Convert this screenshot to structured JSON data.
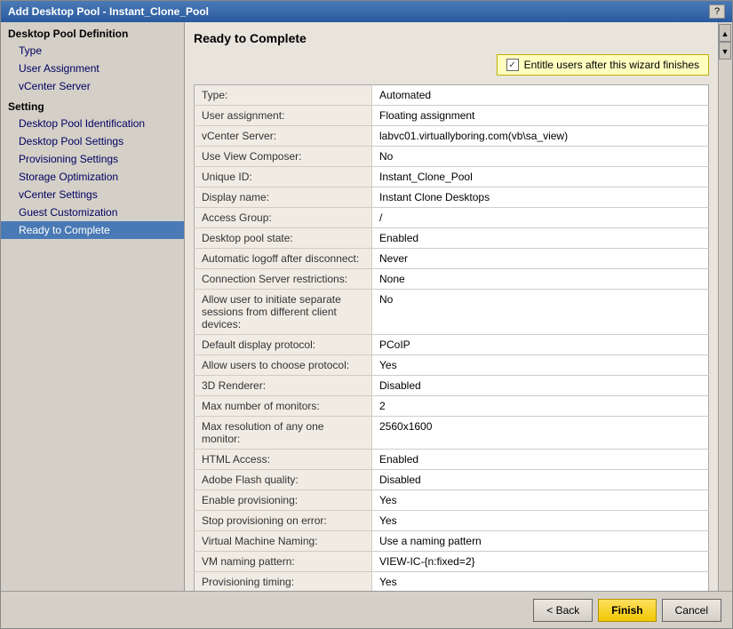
{
  "window": {
    "title": "Add Desktop Pool - Instant_Clone_Pool",
    "help_label": "?"
  },
  "sidebar": {
    "section1_label": "Desktop Pool Definition",
    "items_top": [
      {
        "label": "Type",
        "active": false
      },
      {
        "label": "User Assignment",
        "active": false
      },
      {
        "label": "vCenter Server",
        "active": false
      }
    ],
    "section2_label": "Setting",
    "items_bottom": [
      {
        "label": "Desktop Pool Identification",
        "active": false
      },
      {
        "label": "Desktop Pool Settings",
        "active": false
      },
      {
        "label": "Provisioning Settings",
        "active": false
      },
      {
        "label": "Storage Optimization",
        "active": false
      },
      {
        "label": "vCenter Settings",
        "active": false
      },
      {
        "label": "Guest Customization",
        "active": false
      },
      {
        "label": "Ready to Complete",
        "active": true
      }
    ]
  },
  "content": {
    "page_title": "Ready to Complete",
    "entitle_checkbox_label": "Entitle users after this wizard finishes",
    "entitle_checked": true,
    "table_rows": [
      {
        "label": "Type:",
        "value": "Automated"
      },
      {
        "label": "User assignment:",
        "value": "Floating assignment"
      },
      {
        "label": "vCenter Server:",
        "value": "labvc01.virtuallyboring.com(vb\\sa_view)"
      },
      {
        "label": "Use View Composer:",
        "value": "No"
      },
      {
        "label": "Unique ID:",
        "value": "Instant_Clone_Pool"
      },
      {
        "label": "Display name:",
        "value": "Instant Clone Desktops"
      },
      {
        "label": "Access Group:",
        "value": "/"
      },
      {
        "label": "Desktop pool state:",
        "value": "Enabled"
      },
      {
        "label": "Automatic logoff after disconnect:",
        "value": "Never"
      },
      {
        "label": "Connection Server restrictions:",
        "value": "None"
      },
      {
        "label": "Allow user to initiate separate sessions from different client devices:",
        "value": "No"
      },
      {
        "label": "Default display protocol:",
        "value": "PCoIP"
      },
      {
        "label": "Allow users to choose protocol:",
        "value": "Yes"
      },
      {
        "label": "3D Renderer:",
        "value": "Disabled"
      },
      {
        "label": "Max number of monitors:",
        "value": "2"
      },
      {
        "label": "Max resolution of any one monitor:",
        "value": "2560x1600"
      },
      {
        "label": "HTML Access:",
        "value": "Enabled"
      },
      {
        "label": "Adobe Flash quality:",
        "value": "Disabled"
      },
      {
        "label": "Enable provisioning:",
        "value": "Yes"
      },
      {
        "label": "Stop provisioning on error:",
        "value": "Yes"
      },
      {
        "label": "Virtual Machine Naming:",
        "value": "Use a naming pattern"
      },
      {
        "label": "VM naming pattern:",
        "value": "VIEW-IC-{n:fixed=2}"
      },
      {
        "label": "Provisioning timing:",
        "value": "Yes"
      }
    ]
  },
  "footer": {
    "back_label": "< Back",
    "finish_label": "Finish",
    "cancel_label": "Cancel"
  }
}
